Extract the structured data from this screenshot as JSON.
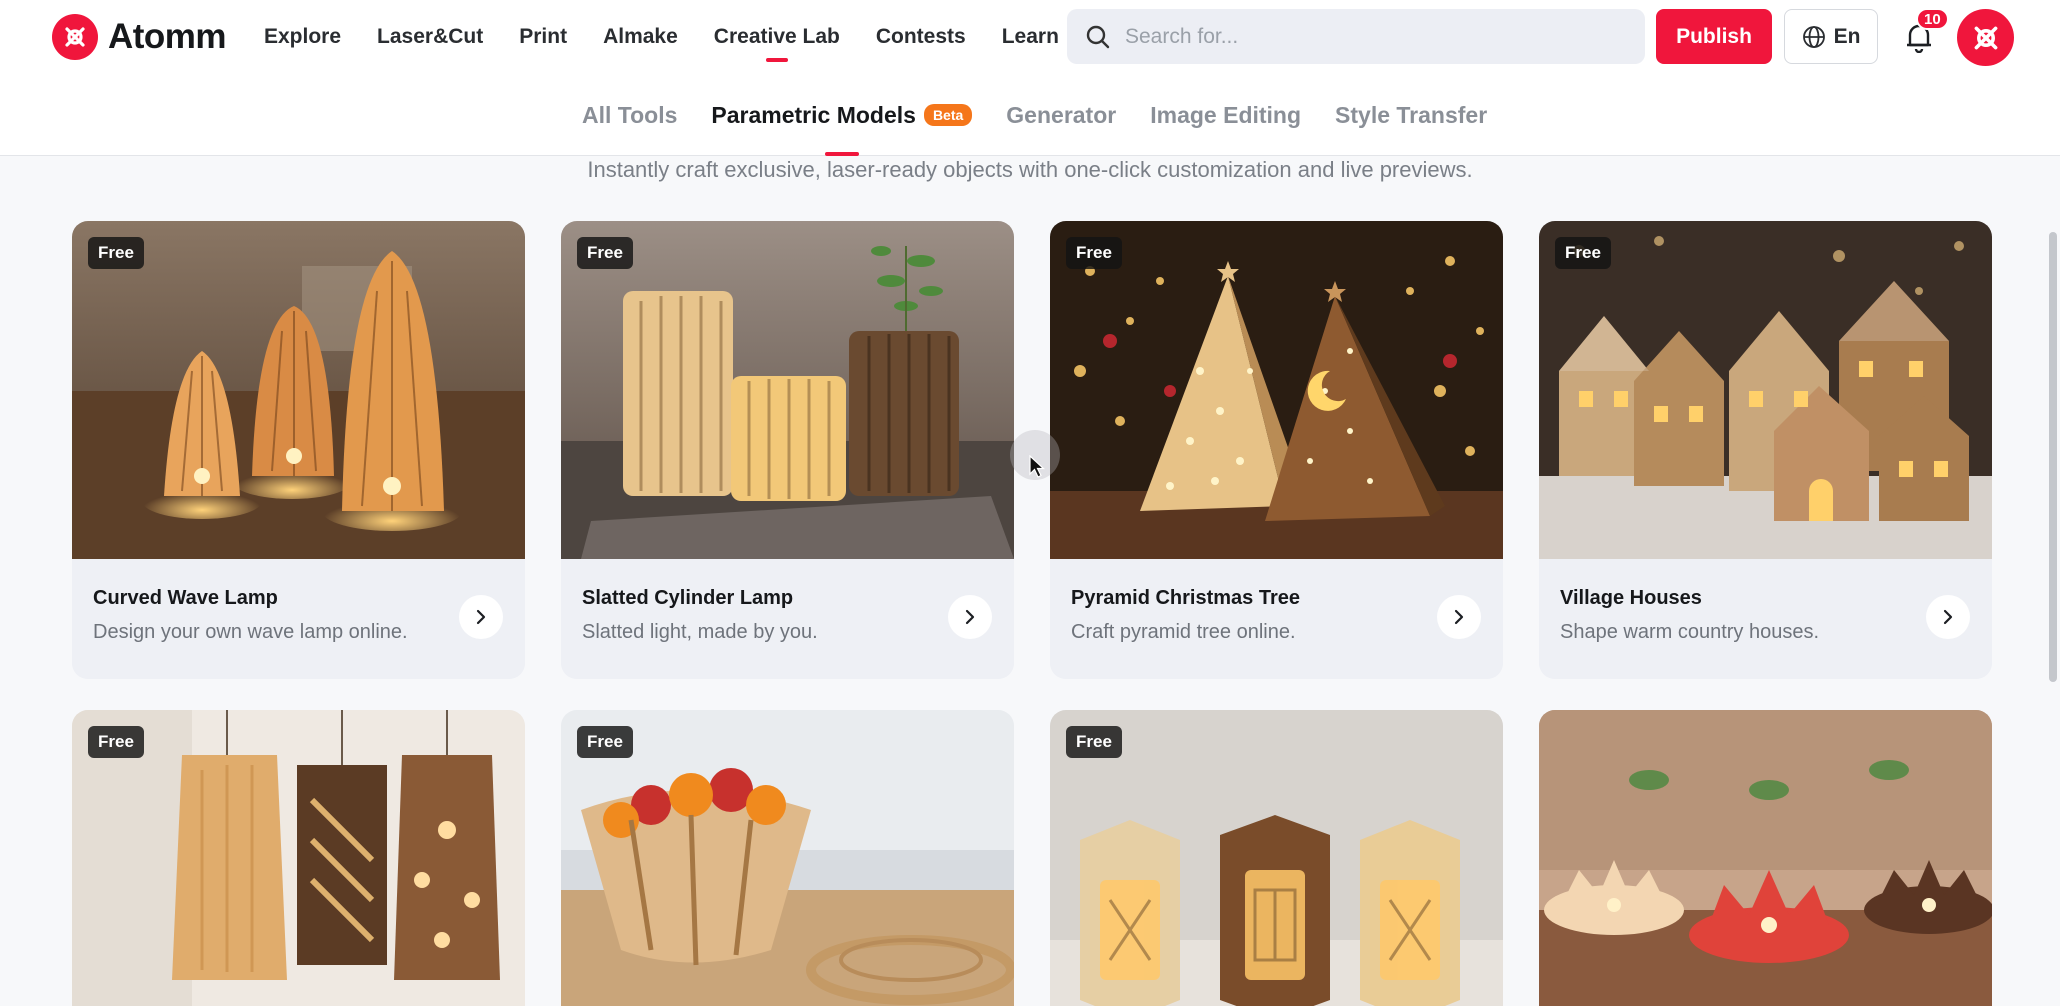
{
  "brand": {
    "name": "Atomm",
    "color": "#f0163c"
  },
  "nav": {
    "items": [
      {
        "label": "Explore"
      },
      {
        "label": "Laser&Cut"
      },
      {
        "label": "Print"
      },
      {
        "label": "Almake"
      },
      {
        "label": "Creative Lab",
        "active": true
      },
      {
        "label": "Contests"
      },
      {
        "label": "Learn",
        "dropdown": true
      }
    ]
  },
  "search": {
    "placeholder": "Search for...",
    "value": ""
  },
  "actions": {
    "publish_label": "Publish",
    "language_label": "En",
    "notification_count": "10"
  },
  "subtabs": {
    "items": [
      {
        "label": "All Tools"
      },
      {
        "label": "Parametric Models",
        "badge": "Beta",
        "active": true
      },
      {
        "label": "Generator"
      },
      {
        "label": "Image Editing"
      },
      {
        "label": "Style Transfer"
      }
    ]
  },
  "tagline": "Instantly craft exclusive, laser-ready objects with one-click customization and live previews.",
  "cards": [
    {
      "badge": "Free",
      "title": "Curved Wave Lamp",
      "description": "Design your own wave lamp online."
    },
    {
      "badge": "Free",
      "title": "Slatted Cylinder Lamp",
      "description": "Slatted light, made by you."
    },
    {
      "badge": "Free",
      "title": "Pyramid Christmas Tree",
      "description": "Craft pyramid tree online."
    },
    {
      "badge": "Free",
      "title": "Village Houses",
      "description": "Shape warm country houses."
    },
    {
      "badge": "Free",
      "title": "",
      "description": ""
    },
    {
      "badge": "Free",
      "title": "",
      "description": ""
    },
    {
      "badge": "Free",
      "title": "",
      "description": ""
    },
    {
      "badge": "",
      "title": "",
      "description": ""
    }
  ]
}
